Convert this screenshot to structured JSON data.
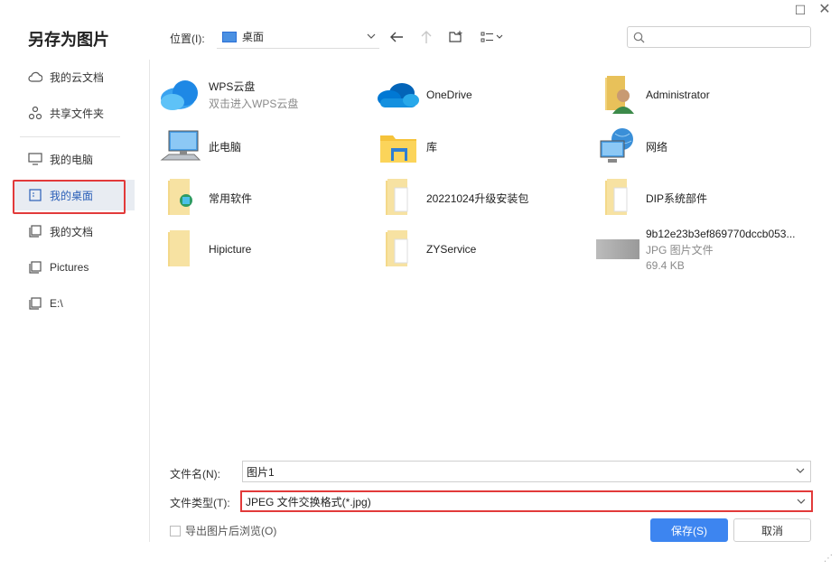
{
  "dialog": {
    "title": "另存为图片"
  },
  "window": {
    "maximize_icon": "maximize-icon",
    "close_icon": "close-icon"
  },
  "sidebar": {
    "items": [
      {
        "label": "我的云文档",
        "icon": "cloud-icon"
      },
      {
        "label": "共享文件夹",
        "icon": "share-icon"
      },
      {
        "label": "我的电脑",
        "icon": "monitor-icon"
      },
      {
        "label": "我的桌面",
        "icon": "desktop-icon",
        "active": true
      },
      {
        "label": "我的文档",
        "icon": "documents-icon"
      },
      {
        "label": "Pictures",
        "icon": "folder-icon"
      },
      {
        "label": "E:\\",
        "icon": "drive-icon"
      }
    ]
  },
  "location": {
    "label": "位置(I):",
    "value": "桌面"
  },
  "search": {
    "placeholder": ""
  },
  "files": [
    {
      "name": "WPS云盘",
      "sub": "双击进入WPS云盘",
      "icon": "wps-cloud-icon"
    },
    {
      "name": "OneDrive",
      "sub": "",
      "icon": "onedrive-icon"
    },
    {
      "name": "Administrator",
      "sub": "",
      "icon": "user-folder-icon"
    },
    {
      "name": "此电脑",
      "sub": "",
      "icon": "computer-icon"
    },
    {
      "name": "库",
      "sub": "",
      "icon": "library-icon"
    },
    {
      "name": "网络",
      "sub": "",
      "icon": "network-icon"
    },
    {
      "name": "常用软件",
      "sub": "",
      "icon": "folder-icon"
    },
    {
      "name": "20221024升级安装包",
      "sub": "",
      "icon": "folder-icon"
    },
    {
      "name": "DIP系统部件",
      "sub": "",
      "icon": "folder-icon"
    },
    {
      "name": "Hipicture",
      "sub": "",
      "icon": "folder-icon"
    },
    {
      "name": "ZYService",
      "sub": "",
      "icon": "folder-icon"
    },
    {
      "name": "9b12e23b3ef869770dccb053...",
      "sub": "JPG 图片文件",
      "sub2": "69.4 KB",
      "icon": "image-thumbnail-icon"
    }
  ],
  "form": {
    "filename_label": "文件名(N):",
    "filename_value": "图片1",
    "filetype_label": "文件类型(T):",
    "filetype_value": "JPEG 文件交换格式(*.jpg)",
    "browse_label": "导出图片后浏览(O)"
  },
  "buttons": {
    "save": "保存(S)",
    "cancel": "取消"
  },
  "colors": {
    "accent": "#3d85f0",
    "highlight": "#e23a3a",
    "active_bg": "#e8ecf2"
  }
}
